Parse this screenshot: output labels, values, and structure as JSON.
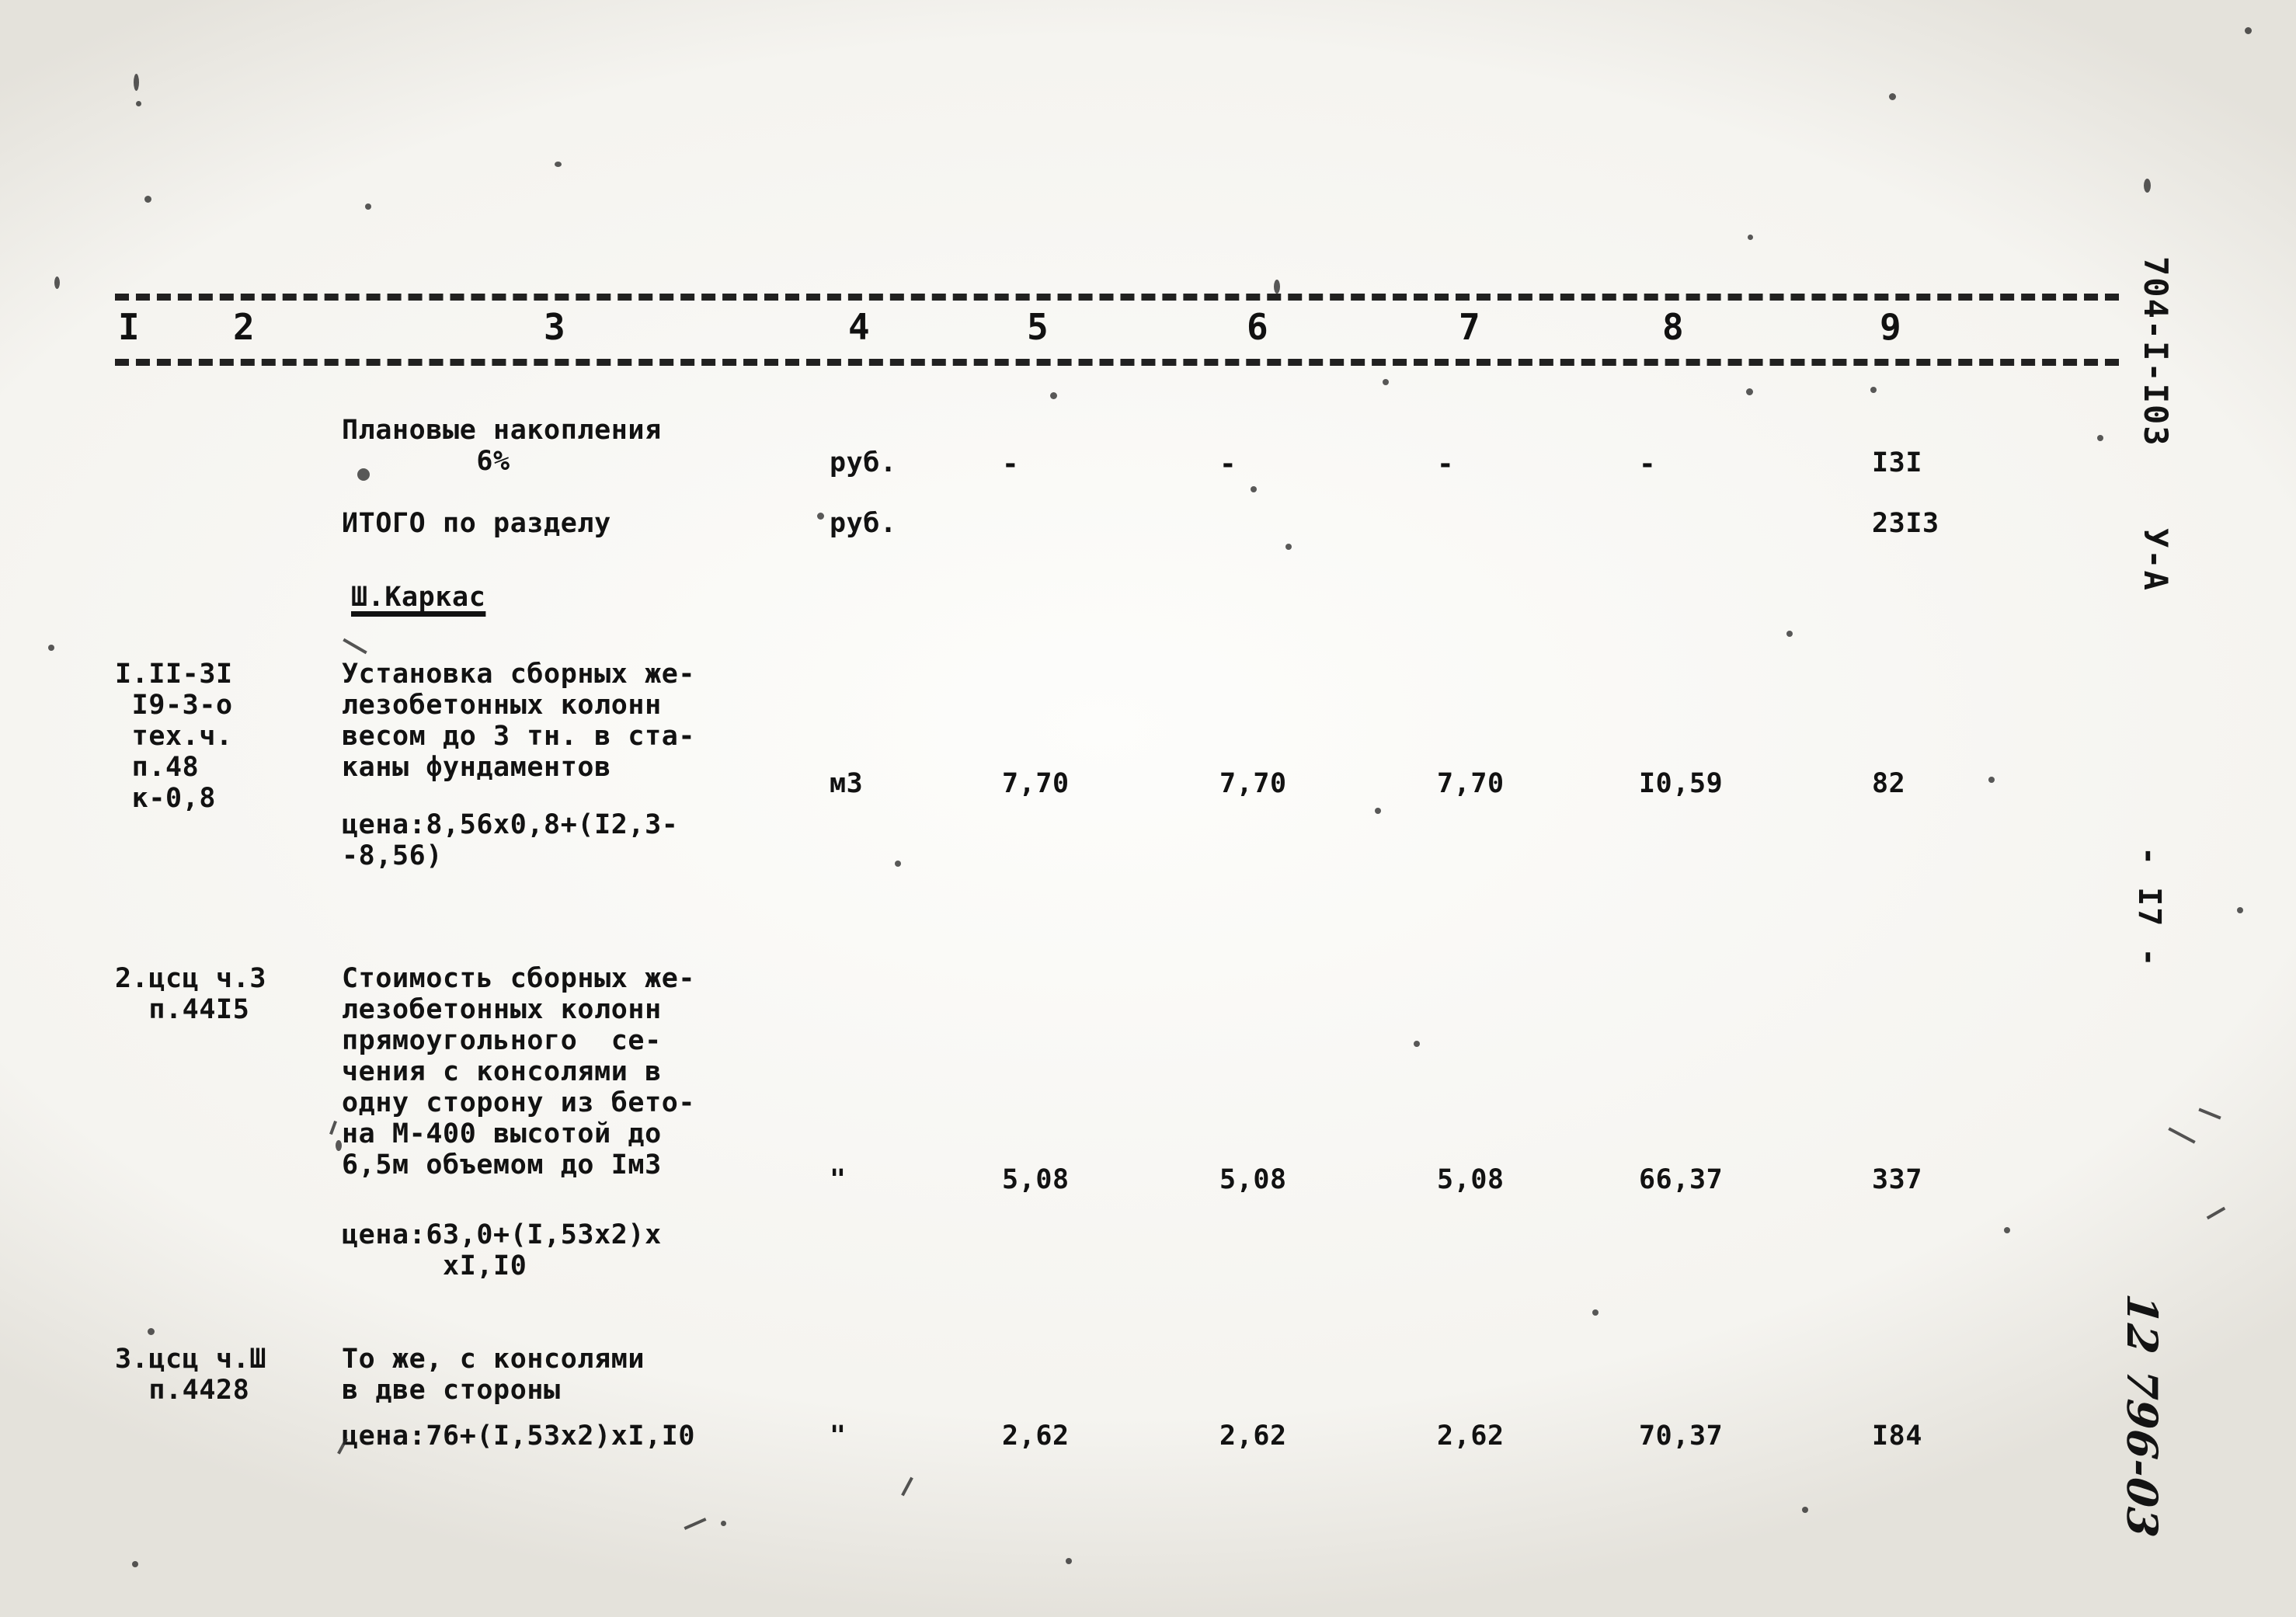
{
  "document": {
    "margin_code": "704-I-I03",
    "margin_series": "У-А",
    "margin_page_no": "- I7 -",
    "margin_handwritten": "12 796-03"
  },
  "table": {
    "column_numbers": [
      "I",
      "2",
      "3",
      "4",
      "5",
      "6",
      "7",
      "8",
      "9"
    ],
    "rows": [
      {
        "code": "",
        "description": "Плановые накопления\n        6%",
        "unit": "руб.",
        "c5": "-",
        "c6": "-",
        "c7": "-",
        "c8": "-",
        "c9": "I3I"
      },
      {
        "code": "",
        "description": "ИТОГО по разделу",
        "unit": "руб.",
        "c5": "",
        "c6": "",
        "c7": "",
        "c8": "",
        "c9": "23I3"
      },
      {
        "code": "",
        "description": "Ш.Каркас",
        "unit": "",
        "c5": "",
        "c6": "",
        "c7": "",
        "c8": "",
        "c9": ""
      },
      {
        "code": "I.II-3I\n I9-3-о\n тех.ч.\n п.48\n к-0,8",
        "description": "Установка сборных же-\nлезобетонных колонн\nвесом до 3 тн. в ста-\nканы фундаментов",
        "note": "цена:8,56х0,8+(I2,3-\n-8,56)",
        "unit": "м3",
        "c5": "7,70",
        "c6": "7,70",
        "c7": "7,70",
        "c8": "I0,59",
        "c9": "82"
      },
      {
        "code": "2.цсц ч.3\n  п.44I5",
        "description": "Стоимость сборных же-\nлезобетонных колонн\nпрямоугольного  се-\nчения с консолями в\nодну сторону из бето-\nна М-400 высотой до\n6,5м объемом до Iм3",
        "note": "цена:63,0+(I,53х2)х\n      хI,I0",
        "unit": "\"",
        "c5": "5,08",
        "c6": "5,08",
        "c7": "5,08",
        "c8": "66,37",
        "c9": "337"
      },
      {
        "code": "3.цсц ч.Ш\n  п.4428",
        "description": "То же, с консолями\nв две стороны",
        "note": "цена:76+(I,53х2)хI,I0",
        "unit": "\"",
        "c5": "2,62",
        "c6": "2,62",
        "c7": "2,62",
        "c8": "70,37",
        "c9": "I84"
      }
    ]
  },
  "section_heading": "Ш.Каркас"
}
